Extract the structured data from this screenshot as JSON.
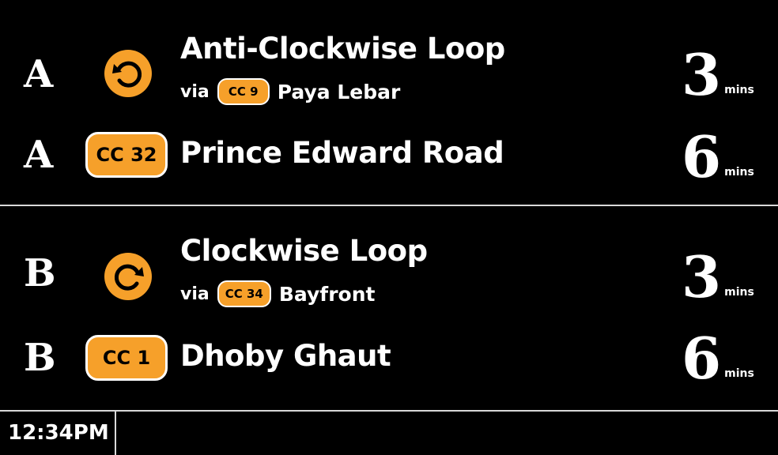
{
  "colors": {
    "background": "#000000",
    "text": "#FFFFFF",
    "line_badge": "#F6A02A",
    "divider": "#D9D9D9"
  },
  "time_unit": "mins",
  "rows": [
    {
      "platform": "A",
      "icon": "anticlockwise-loop-icon",
      "destination": "Anti-Clockwise Loop",
      "via_label": "via",
      "via_code": "CC 9",
      "via_station": "Paya Lebar",
      "minutes": "3"
    },
    {
      "platform": "A",
      "station_code": "CC 32",
      "destination": "Prince Edward Road",
      "minutes": "6"
    },
    {
      "platform": "B",
      "icon": "clockwise-loop-icon",
      "destination": "Clockwise Loop",
      "via_label": "via",
      "via_code": "CC 34",
      "via_station": "Bayfront",
      "minutes": "3"
    },
    {
      "platform": "B",
      "station_code": "CC 1",
      "destination": "Dhoby Ghaut",
      "minutes": "6"
    }
  ],
  "footer": {
    "clock": "12:34PM"
  }
}
